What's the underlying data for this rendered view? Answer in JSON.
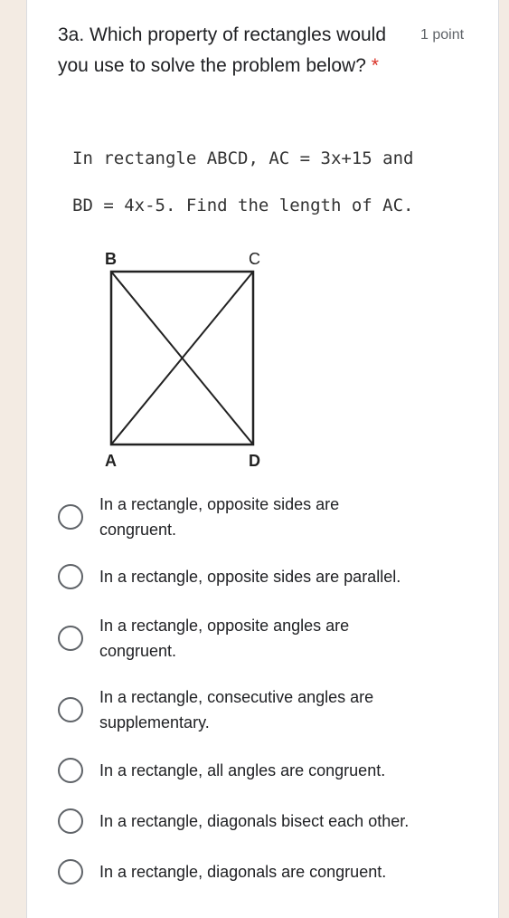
{
  "question": {
    "title": "3a. Which property of rectangles would you use to solve the problem below?",
    "required_mark": "*",
    "points": "1 point"
  },
  "problem": {
    "line1": "In rectangle ABCD, AC = 3x+15 and",
    "line2": "BD = 4x-5. Find the length of AC."
  },
  "figure": {
    "labels": {
      "B": "B",
      "C": "C",
      "A": "A",
      "D": "D"
    }
  },
  "options": [
    "In a rectangle, opposite sides are congruent.",
    "In a rectangle, opposite sides are parallel.",
    "In a rectangle, opposite angles are congruent.",
    "In a rectangle, consecutive angles are supplementary.",
    "In a rectangle, all angles are congruent.",
    "In a rectangle, diagonals bisect each other.",
    "In a rectangle, diagonals are congruent."
  ]
}
